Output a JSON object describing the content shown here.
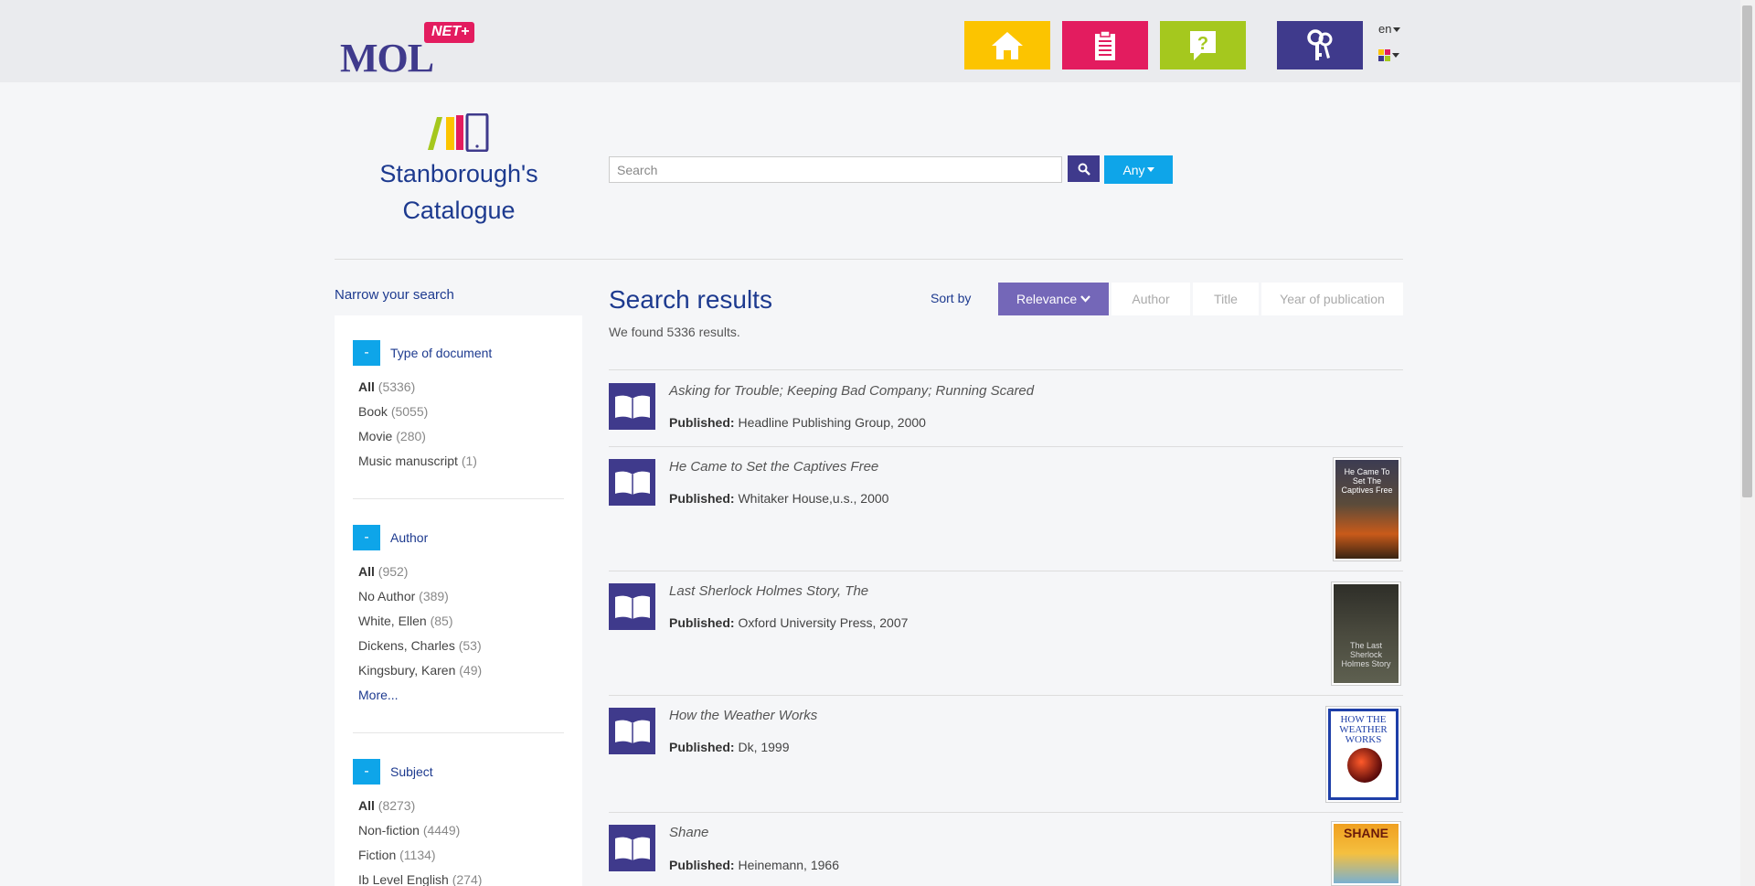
{
  "header": {
    "logo_text": "MOL",
    "logo_badge": "NET+",
    "language": "en",
    "nav": [
      {
        "name": "home-icon",
        "color": "#fcc400"
      },
      {
        "name": "clipboard-icon",
        "color": "#e31c5f"
      },
      {
        "name": "help-icon",
        "color": "#a5c81e"
      },
      {
        "name": "keys-icon",
        "color": "#3f3a8c"
      }
    ]
  },
  "catalogue": {
    "title_line1": "Stanborough's",
    "title_line2": "Catalogue"
  },
  "search": {
    "placeholder": "Search",
    "scope_label": "Any"
  },
  "sidebar": {
    "heading": "Narrow your search",
    "facets": [
      {
        "toggle": "-",
        "label": "Type of document",
        "items": [
          {
            "name": "All",
            "count": "(5336)"
          },
          {
            "name": "Book",
            "count": "(5055)"
          },
          {
            "name": "Movie",
            "count": "(280)"
          },
          {
            "name": "Music manuscript",
            "count": "(1)"
          }
        ]
      },
      {
        "toggle": "-",
        "label": "Author",
        "items": [
          {
            "name": "All",
            "count": "(952)"
          },
          {
            "name": "No Author",
            "count": "(389)"
          },
          {
            "name": "White, Ellen",
            "count": "(85)"
          },
          {
            "name": "Dickens, Charles",
            "count": "(53)"
          },
          {
            "name": "Kingsbury, Karen",
            "count": "(49)"
          }
        ],
        "more": "More..."
      },
      {
        "toggle": "-",
        "label": "Subject",
        "items": [
          {
            "name": "All",
            "count": "(8273)"
          },
          {
            "name": "Non-fiction",
            "count": "(4449)"
          },
          {
            "name": "Fiction",
            "count": "(1134)"
          },
          {
            "name": "Ib Level English",
            "count": "(274)"
          }
        ]
      }
    ]
  },
  "results": {
    "title": "Search results",
    "found_text": "We found 5336 results.",
    "sort_label": "Sort by",
    "sort_options": [
      "Relevance",
      "Author",
      "Title",
      "Year of publication"
    ],
    "published_label": "Published:",
    "items": [
      {
        "title": "Asking for Trouble; Keeping Bad Company; Running Scared",
        "published": "Headline Publishing Group, 2000"
      },
      {
        "title": "He Came to Set the Captives Free",
        "published": "Whitaker House,u.s., 2000",
        "cover_text": "He Came To Set The Captives Free"
      },
      {
        "title": "Last Sherlock Holmes Story, The",
        "published": "Oxford University Press, 2007",
        "cover_text": "The Last Sherlock Holmes Story"
      },
      {
        "title": "How the Weather Works",
        "published": "Dk, 1999",
        "cover_text": "HOW THE WEATHER WORKS"
      },
      {
        "title": "Shane",
        "published": "Heinemann, 1966",
        "cover_text": "SHANE"
      }
    ]
  },
  "colors": {
    "brand_purple": "#3f3a8c",
    "accent_blue": "#0ea5e9",
    "sort_active": "#7467b8"
  }
}
